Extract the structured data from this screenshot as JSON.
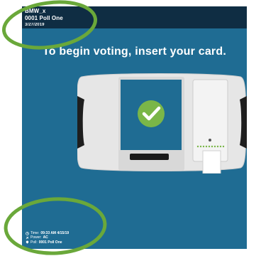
{
  "header": {
    "model": "BMW_x",
    "poll": "0001 Poll One",
    "date": "3/27/2019"
  },
  "main": {
    "instruction": "To begin voting, insert your card."
  },
  "footer": {
    "time_label": "Time:",
    "time_value": "09:33 AM 4/15/19",
    "power_label": "Power:",
    "power_value": "AC",
    "poll_label": "Poll:",
    "poll_value": "0001 Poll One"
  },
  "colors": {
    "screen_bg": "#1f6c93",
    "header_bg": "#0f2d43",
    "checkmark_bg": "#7ab648",
    "annotation_green": "#6aa83a"
  },
  "icons": {
    "checkmark": "check-circle-icon",
    "time": "clock-icon",
    "power": "plug-icon",
    "poll": "poll-icon"
  }
}
